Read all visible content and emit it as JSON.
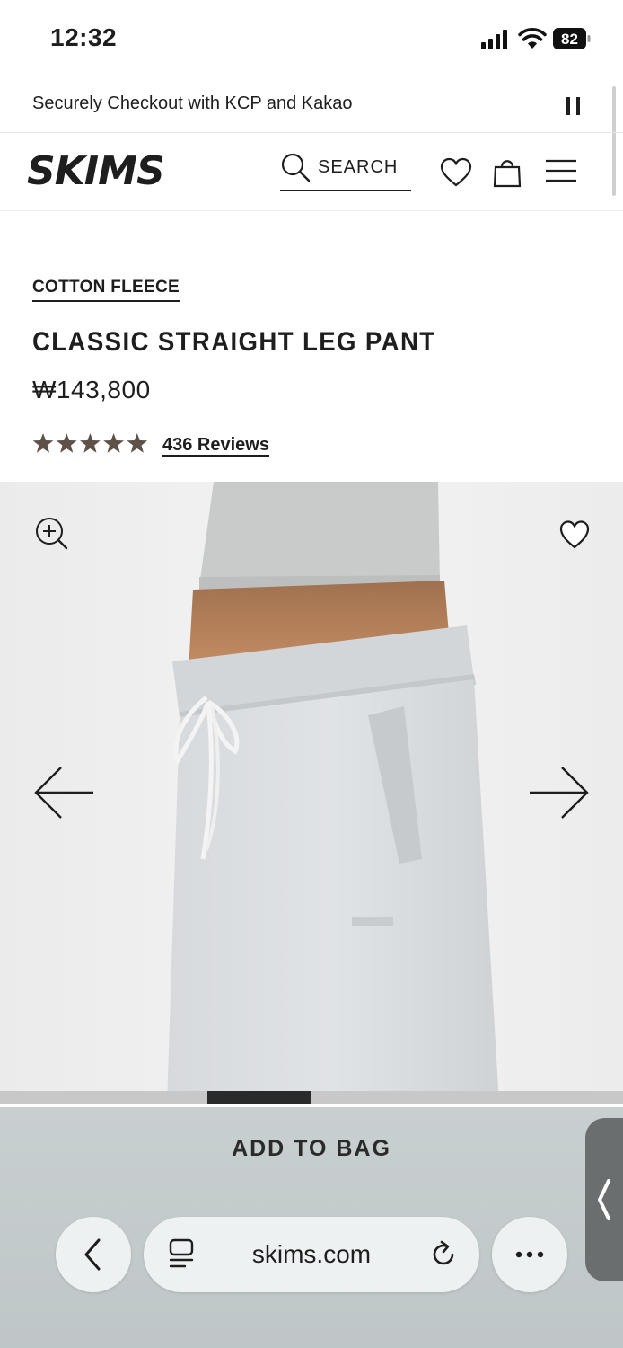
{
  "status_bar": {
    "time": "12:32",
    "battery": "82",
    "icons": [
      "signal-icon",
      "wifi-icon",
      "battery-icon"
    ]
  },
  "announcement": {
    "text": "Securely Checkout with KCP and Kakao",
    "icon": "pause-icon"
  },
  "header": {
    "logo": "SKIMS",
    "search_label": "SEARCH",
    "icons": [
      "search-icon",
      "heart-icon",
      "shopping-bag-icon",
      "hamburger-menu-icon"
    ]
  },
  "product": {
    "collection": "COTTON FLEECE",
    "title": "CLASSIC STRAIGHT LEG PANT",
    "price": "₩143,800",
    "rating": 5,
    "rating_max": 5,
    "reviews_label": "436 Reviews",
    "star_color": "#5e5248"
  },
  "gallery": {
    "icons": [
      "zoom-in-icon",
      "heart-icon",
      "arrow-left-icon",
      "arrow-right-icon"
    ],
    "slide_progress": 0.17
  },
  "bottom": {
    "add_to_bag_label": "ADD TO BAG",
    "url": "skims.com",
    "icons": [
      "chevron-left-icon",
      "tabs-icon",
      "reload-icon",
      "more-icon",
      "chevron-left-handle-icon"
    ]
  }
}
